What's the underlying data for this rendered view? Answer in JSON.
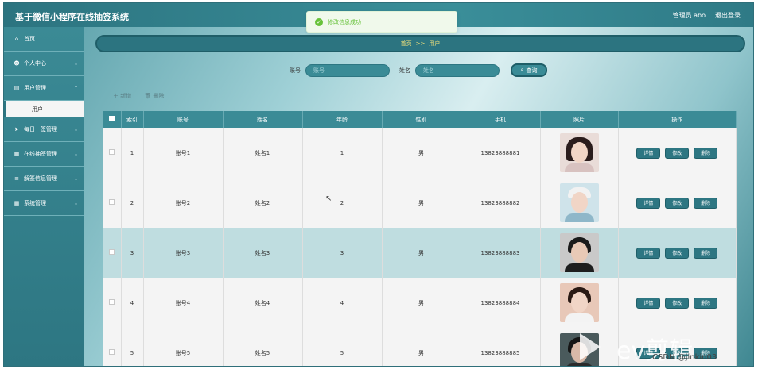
{
  "app": {
    "title": "基于微信小程序在线抽签系统",
    "admin_label": "管理员 abo",
    "logout": "退出登录"
  },
  "toast": {
    "message": "修改信息成功"
  },
  "sidebar": {
    "items": [
      {
        "label": "首页",
        "icon": "home-icon",
        "glyph": "⌂",
        "chevron": false
      },
      {
        "label": "个人中心",
        "icon": "user-icon",
        "glyph": "☻",
        "chevron": true
      },
      {
        "label": "用户管理",
        "icon": "document-icon",
        "glyph": "▤",
        "chevron": true
      },
      {
        "label": "每日一签管理",
        "icon": "send-icon",
        "glyph": "➤",
        "chevron": true
      },
      {
        "label": "在线抽签管理",
        "icon": "grid-icon",
        "glyph": "▦",
        "chevron": true
      },
      {
        "label": "解签信息管理",
        "icon": "list-icon",
        "glyph": "≡",
        "chevron": true
      },
      {
        "label": "系统管理",
        "icon": "grid-icon",
        "glyph": "▦",
        "chevron": true
      }
    ],
    "sub_item": "用户"
  },
  "breadcrumb": {
    "home": "首页",
    "sep": ">>",
    "current": "用户"
  },
  "search": {
    "account_label": "账号",
    "account_placeholder": "账号",
    "name_label": "姓名",
    "name_placeholder": "姓名",
    "button": "查询"
  },
  "toolbar": {
    "add": "＋ 新增",
    "delete": "🗑 删除"
  },
  "table": {
    "headers": [
      "索引",
      "账号",
      "姓名",
      "年龄",
      "性别",
      "手机",
      "照片",
      "操作"
    ],
    "rows": [
      {
        "index": "1",
        "account": "账号1",
        "name": "姓名1",
        "age": "1",
        "gender": "男",
        "phone": "13823888881"
      },
      {
        "index": "2",
        "account": "账号2",
        "name": "姓名2",
        "age": "2",
        "gender": "男",
        "phone": "13823888882"
      },
      {
        "index": "3",
        "account": "账号3",
        "name": "姓名3",
        "age": "3",
        "gender": "男",
        "phone": "13823888883"
      },
      {
        "index": "4",
        "account": "账号4",
        "name": "姓名4",
        "age": "4",
        "gender": "男",
        "phone": "13823888884"
      },
      {
        "index": "5",
        "account": "账号5",
        "name": "姓名5",
        "age": "5",
        "gender": "男",
        "phone": "13823888885"
      }
    ],
    "ops": {
      "detail": "详情",
      "edit": "修改",
      "delete": "删除"
    }
  },
  "watermark": {
    "brand": "ev剪辑",
    "credit": "CSDN @jinkin03"
  },
  "colors": {
    "primary": "#2d7682",
    "header": "#3b8b96",
    "breadcrumb_text": "#f3e27a",
    "success": "#67c23a"
  }
}
